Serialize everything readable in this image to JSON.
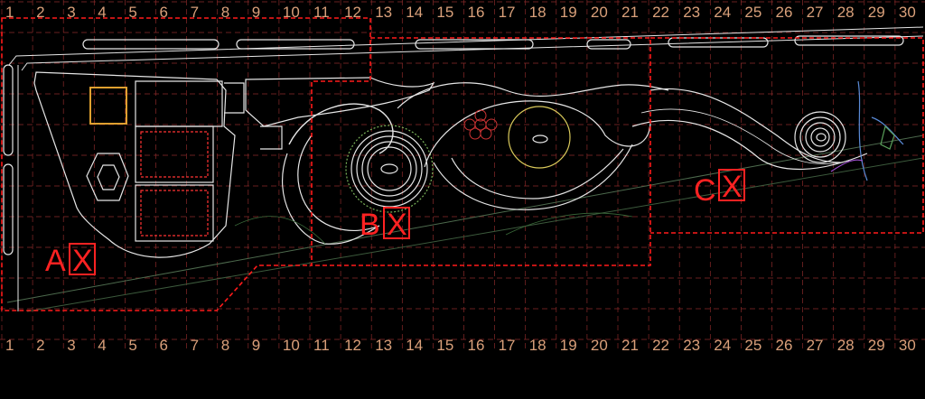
{
  "grid": {
    "top_numbers": [
      "1",
      "2",
      "3",
      "4",
      "5",
      "6",
      "7",
      "8",
      "9",
      "10",
      "11",
      "12",
      "13",
      "14",
      "15",
      "16",
      "17",
      "18",
      "19",
      "20",
      "21",
      "22",
      "23",
      "24",
      "25",
      "26",
      "27",
      "28",
      "29",
      "30"
    ],
    "bottom_numbers": [
      "1",
      "2",
      "3",
      "4",
      "5",
      "6",
      "7",
      "8",
      "9",
      "10",
      "11",
      "12",
      "13",
      "14",
      "15",
      "16",
      "17",
      "18",
      "19",
      "20",
      "21",
      "22",
      "23",
      "24",
      "25",
      "26",
      "27",
      "28",
      "29",
      "30"
    ]
  },
  "zones": [
    {
      "letter": "A",
      "mark": "X"
    },
    {
      "letter": "B",
      "mark": "X"
    },
    {
      "letter": "C",
      "mark": "X"
    }
  ],
  "colors": {
    "background": "#000000",
    "grid_line": "#8a2a2a",
    "grid_number": "#d9a07a",
    "zone_boundary": "#ff1a1a",
    "drawing_line": "#e8e8e8"
  }
}
